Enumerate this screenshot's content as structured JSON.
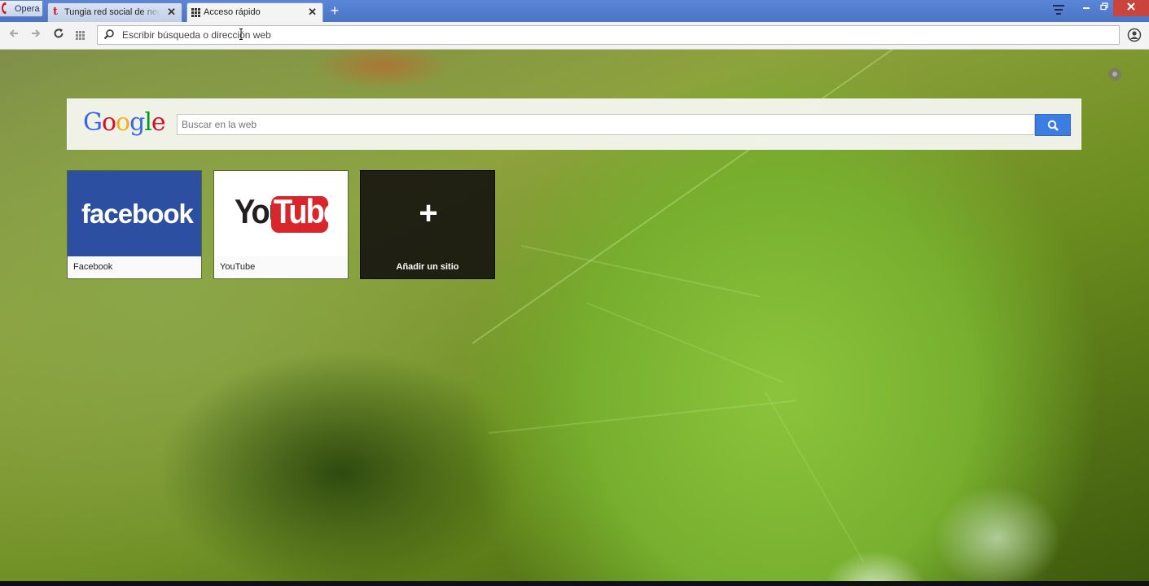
{
  "browser": {
    "menu_label": "Opera",
    "tabs": [
      {
        "title": "Tungia red social de negocios",
        "favicon": "t-letter-icon",
        "active": false
      },
      {
        "title": "Acceso rápido",
        "favicon": "speed-dial-grid-icon",
        "active": true
      }
    ],
    "new_tab_glyph": "+",
    "close_glyph": "✕"
  },
  "toolbar": {
    "address_placeholder": "Escribir búsqueda o dirección web",
    "address_value": ""
  },
  "speed_dial": {
    "search": {
      "logo_letters": [
        "G",
        "o",
        "o",
        "g",
        "l",
        "e"
      ],
      "placeholder": "Buscar en la web"
    },
    "tiles": [
      {
        "caption": "Facebook",
        "thumb_text": "facebook"
      },
      {
        "caption": "YouTube",
        "thumb_you": "You",
        "thumb_tube": "Tube"
      },
      {
        "caption": "Añadir un sitio",
        "thumb_glyph": "+"
      }
    ]
  },
  "colors": {
    "tabstrip": "#4a74c6",
    "close_button": "#c9443c",
    "facebook_blue": "#2d4fa2",
    "youtube_red": "#d9262b",
    "search_button": "#3b7de0"
  }
}
